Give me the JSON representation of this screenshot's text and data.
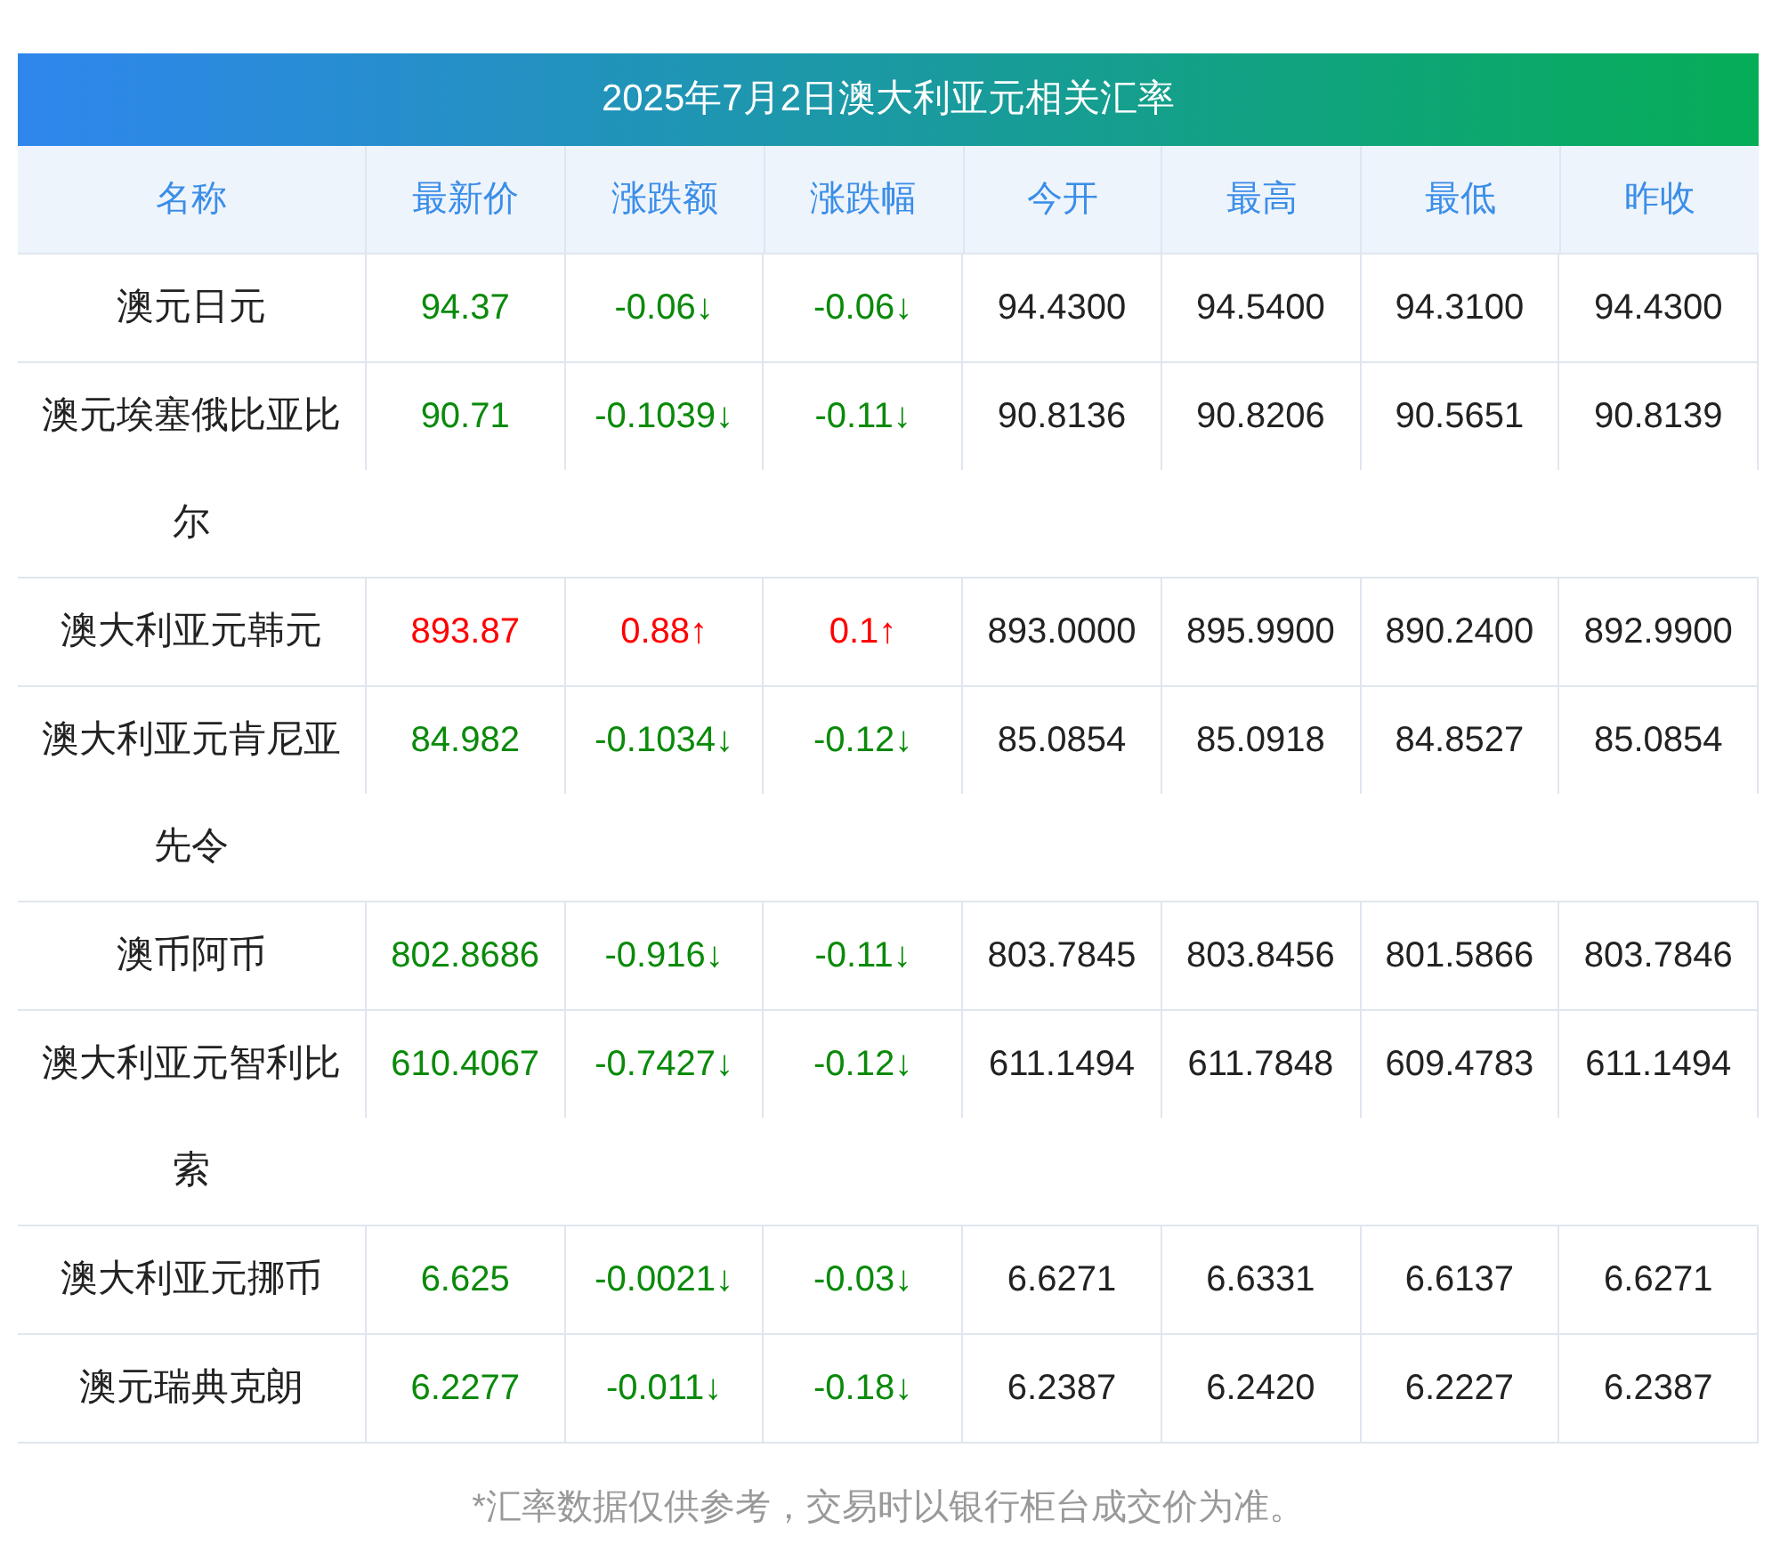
{
  "title": "2025年7月2日澳大利亚元相关汇率",
  "columns": [
    "名称",
    "最新价",
    "涨跌额",
    "涨跌幅",
    "今开",
    "最高",
    "最低",
    "昨收"
  ],
  "rows": [
    {
      "name": "澳元日元",
      "color": "#0a8a0a",
      "cells": [
        "94.37",
        "-0.06↓",
        "-0.06↓",
        "94.4300",
        "94.5400",
        "94.3100",
        "94.4300"
      ]
    },
    {
      "name": "澳元埃塞俄比亚比尔",
      "color": "#0a8a0a",
      "cells": [
        "90.71",
        "-0.1039↓",
        "-0.11↓",
        "90.8136",
        "90.8206",
        "90.5651",
        "90.8139"
      ]
    },
    {
      "name": "澳大利亚元韩元",
      "color": "#ff0000",
      "cells": [
        "893.87",
        "0.88↑",
        "0.1↑",
        "893.0000",
        "895.9900",
        "890.2400",
        "892.9900"
      ]
    },
    {
      "name": "澳大利亚元肯尼亚先令",
      "color": "#0a8a0a",
      "cells": [
        "84.982",
        "-0.1034↓",
        "-0.12↓",
        "85.0854",
        "85.0918",
        "84.8527",
        "85.0854"
      ]
    },
    {
      "name": "澳币阿币",
      "color": "#0a8a0a",
      "cells": [
        "802.8686",
        "-0.916↓",
        "-0.11↓",
        "803.7845",
        "803.8456",
        "801.5866",
        "803.7846"
      ]
    },
    {
      "name": "澳大利亚元智利比索",
      "color": "#0a8a0a",
      "cells": [
        "610.4067",
        "-0.7427↓",
        "-0.12↓",
        "611.1494",
        "611.7848",
        "609.4783",
        "611.1494"
      ]
    },
    {
      "name": "澳大利亚元挪币",
      "color": "#0a8a0a",
      "cells": [
        "6.625",
        "-0.0021↓",
        "-0.03↓",
        "6.6271",
        "6.6331",
        "6.6137",
        "6.6271"
      ]
    },
    {
      "name": "澳元瑞典克朗",
      "color": "#0a8a0a",
      "cells": [
        "6.2277",
        "-0.011↓",
        "-0.18↓",
        "6.2387",
        "6.2420",
        "6.2227",
        "6.2387"
      ]
    }
  ],
  "footnote": "*汇率数据仅供参考，交易时以银行柜台成交价为准。"
}
